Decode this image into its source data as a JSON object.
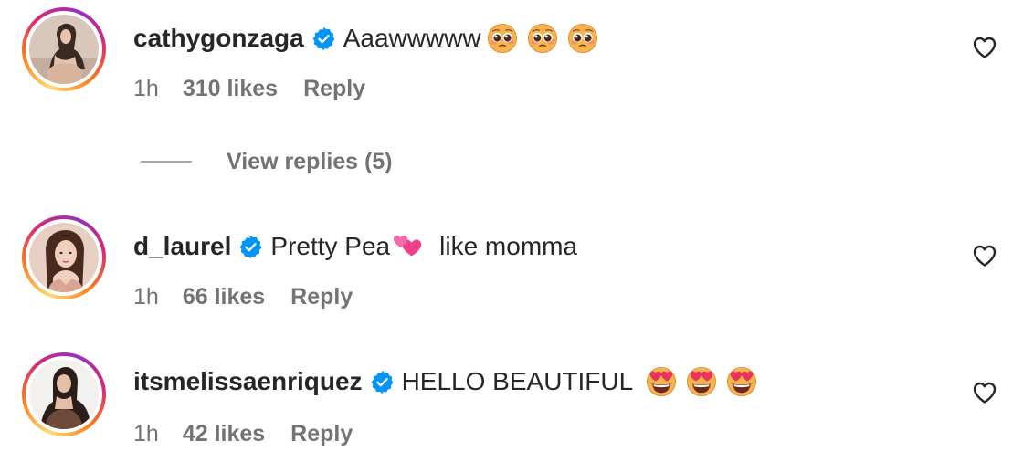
{
  "comments": [
    {
      "username": "cathygonzaga",
      "verified": true,
      "text": "Aaawwwww",
      "emoji": [
        "pleading-face",
        "pleading-face",
        "pleading-face"
      ],
      "time": "1h",
      "likes": "310 likes",
      "reply_label": "Reply",
      "view_replies": "View replies (5)"
    },
    {
      "username": "d_laurel",
      "verified": true,
      "text": "Pretty Pea",
      "emoji": [
        "two-hearts"
      ],
      "text_after": "like momma",
      "time": "1h",
      "likes": "66 likes",
      "reply_label": "Reply"
    },
    {
      "username": "itsmelissaenriquez",
      "verified": true,
      "text": "HELLO BEAUTIFUL",
      "emoji": [
        "heart-eyes-face",
        "heart-eyes-face",
        "heart-eyes-face"
      ],
      "time": "1h",
      "likes": "42 likes",
      "reply_label": "Reply"
    }
  ],
  "colors": {
    "text": "#262626",
    "meta": "#737373",
    "verified_blue": "#0095f6",
    "story_ring": [
      "#feda75",
      "#fa7e1e",
      "#d62976",
      "#962fbf"
    ]
  },
  "icons": [
    "verified-badge-icon",
    "heart-outline-icon",
    "pleading-face-emoji",
    "two-hearts-emoji",
    "heart-eyes-emoji"
  ]
}
